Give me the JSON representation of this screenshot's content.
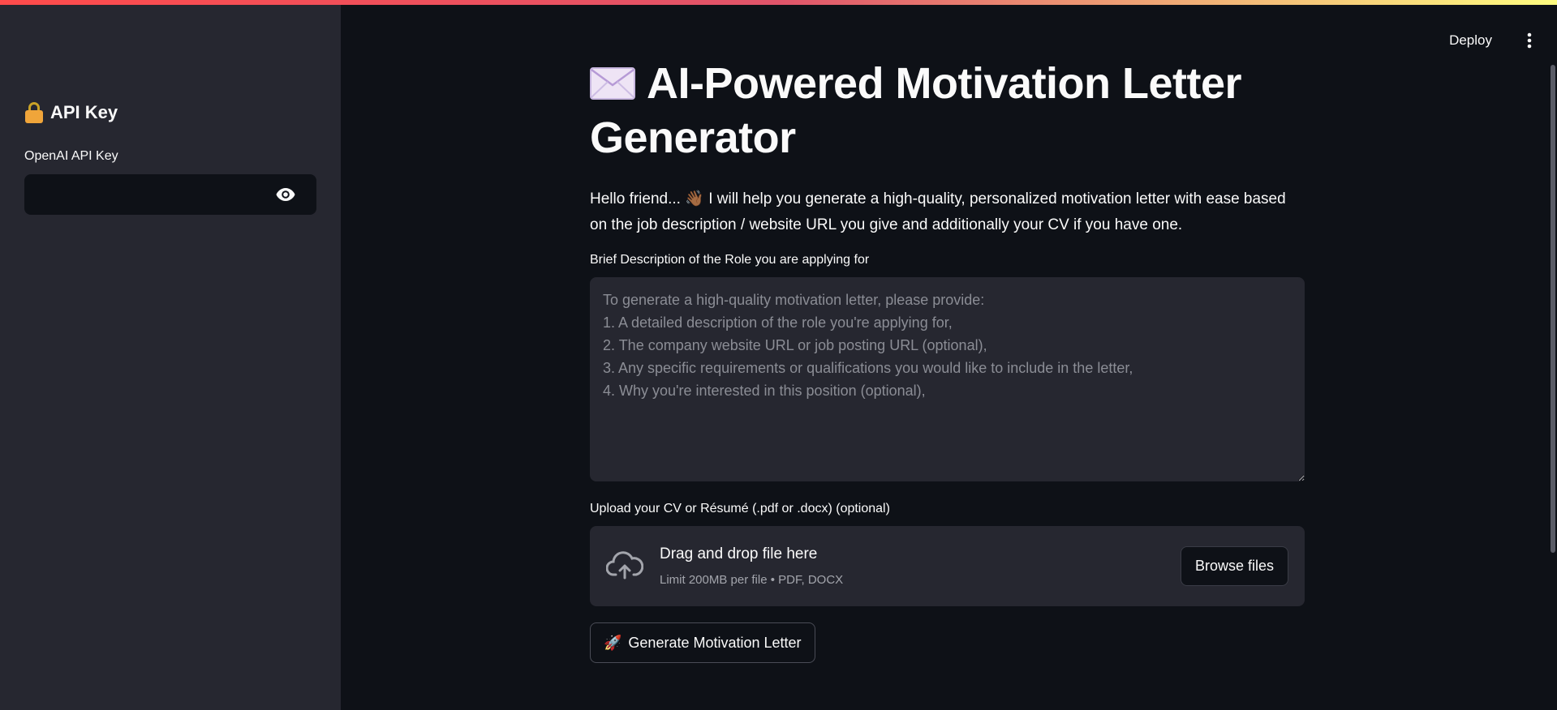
{
  "sidebar": {
    "title": "API Key",
    "api_key_label": "OpenAI API Key",
    "api_key_value": ""
  },
  "header": {
    "deploy_label": "Deploy"
  },
  "main": {
    "title": "AI-Powered Motivation Letter Generator",
    "intro_before_emoji": "Hello friend...",
    "intro_emoji": "👋🏾",
    "intro_after_emoji": "I will help you generate a high-quality, personalized motivation letter with ease based on the job description / website URL you give and additionally your CV if you have one.",
    "role_label": "Brief Description of the Role you are applying for",
    "role_placeholder": "To generate a high-quality motivation letter, please provide:\n1. A detailed description of the role you're applying for,\n2. The company website URL or job posting URL (optional),\n3. Any specific requirements or qualifications you would like to include in the letter,\n4. Why you're interested in this position (optional),",
    "upload_label": "Upload your CV or Résumé (.pdf or .docx) (optional)",
    "drop_title": "Drag and drop file here",
    "drop_limit": "Limit 200MB per file • PDF, DOCX",
    "browse_label": "Browse files",
    "generate_emoji": "🚀",
    "generate_label": "Generate Motivation Letter"
  },
  "icons": [
    "lock-icon",
    "eye-icon",
    "kebab-menu-icon",
    "envelope-icon",
    "wave-icon",
    "cloud-upload-icon",
    "rocket-icon"
  ],
  "colors": {
    "background": "#0e1117",
    "sidebar": "#262730",
    "field": "#262730",
    "accent_gradient_start": "#ff4b4b",
    "accent_gradient_end": "#fffd80"
  }
}
